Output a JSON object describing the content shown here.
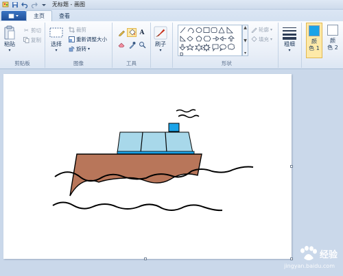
{
  "window": {
    "title": "无标题 - 画图"
  },
  "quick_access": {
    "icons": [
      "paint-app-icon",
      "save-icon",
      "undo-icon",
      "redo-icon",
      "customize-dropdown-icon"
    ]
  },
  "tabs": [
    {
      "label": "主页",
      "active": true
    },
    {
      "label": "查看",
      "active": false
    }
  ],
  "ribbon": {
    "clipboard": {
      "label": "剪贴板",
      "paste": "粘贴",
      "cut": "剪切",
      "copy": "复制"
    },
    "image": {
      "label": "图像",
      "select": "选择",
      "crop": "裁剪",
      "resize": "重新调整大小",
      "rotate": "旋转"
    },
    "tools": {
      "label": "工具",
      "items": [
        "pencil-icon",
        "fill-bucket-icon",
        "text-tool-icon",
        "eraser-icon",
        "color-picker-icon",
        "magnifier-icon"
      ],
      "selected": "fill-bucket-icon",
      "text_glyph": "A"
    },
    "brushes": {
      "label": "刷子"
    },
    "shapes": {
      "label": "形状",
      "outline": "轮廓",
      "fill": "填充"
    },
    "size": {
      "label": "粗细"
    },
    "color1": {
      "label": "颜色 1",
      "line1": "颜",
      "line2": "色 1",
      "value": "#1aa3e8"
    },
    "color2": {
      "label": "颜色 2",
      "line1": "颜",
      "line2": "色 2",
      "value": "#ffffff"
    }
  },
  "canvas": {
    "background": "#ffffff",
    "boat_hull_color": "#b8765a",
    "cabin_color": "#a8d8ea",
    "chimney_color": "#1aa3e8",
    "deck_color": "#1aa3e8",
    "line_color": "#000000"
  },
  "watermark": {
    "text": "经验",
    "sub": "jingyan.baidu.com"
  }
}
